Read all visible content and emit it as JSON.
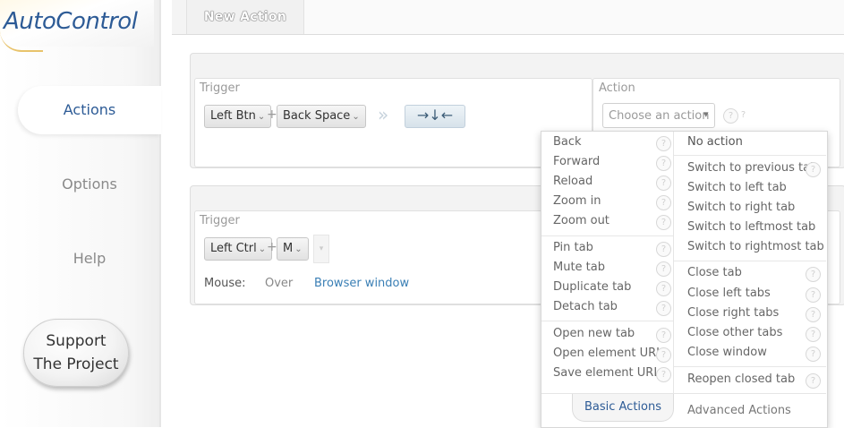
{
  "app": {
    "logo": "AutoControl"
  },
  "sidebar": {
    "items": [
      {
        "label": "Actions",
        "active": true
      },
      {
        "label": "Options",
        "active": false
      },
      {
        "label": "Help",
        "active": false
      }
    ],
    "support": {
      "line1": "Support",
      "line2": "The Project"
    }
  },
  "header": {
    "tab_label": "New Action"
  },
  "action_rule_1": {
    "trigger_title": "Trigger",
    "keys": [
      "Left Btn",
      "Back Space"
    ],
    "plus": "+",
    "arrow_separator": "»",
    "direction_symbols": "→↓←",
    "action_title": "Action",
    "action_select": {
      "placeholder": "Choose an action",
      "caret": "▾"
    }
  },
  "action_rule_2": {
    "trigger_title": "Trigger",
    "keys": [
      "Left Ctrl",
      "M"
    ],
    "plus": "+",
    "mouse_label": "Mouse:",
    "mouse_mode": "Over",
    "mouse_target": "Browser window"
  },
  "dropdown": {
    "left_groups": [
      [
        "Back",
        "Forward",
        "Reload",
        "Zoom in",
        "Zoom out"
      ],
      [
        "Pin tab",
        "Mute tab",
        "Duplicate tab",
        "Detach tab"
      ],
      [
        "Open new tab",
        "Open element URL",
        "Save element URL"
      ]
    ],
    "right_groups": [
      [
        "No action"
      ],
      [
        "Switch to previous tab",
        "Switch to left tab",
        "Switch to right tab",
        "Switch to leftmost tab",
        "Switch to rightmost tab"
      ],
      [
        "Close tab",
        "Close left tabs",
        "Close right tabs",
        "Close other tabs",
        "Close window"
      ],
      [
        "Reopen closed tab"
      ]
    ],
    "tabs": {
      "basic": "Basic Actions",
      "advanced": "Advanced Actions"
    },
    "help_glyph": "?"
  },
  "colors": {
    "accent": "#2d5b96",
    "link": "#3a7fb5",
    "muted": "#9a9a9a"
  }
}
